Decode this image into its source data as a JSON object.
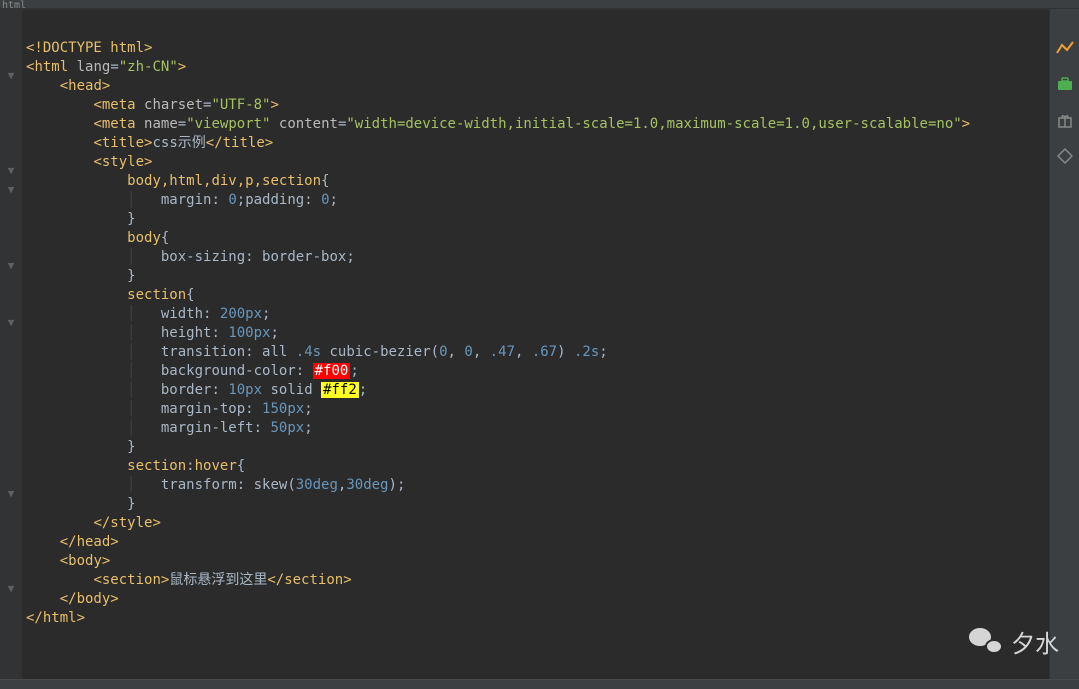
{
  "topbar": {
    "label": "html"
  },
  "folds": [
    "",
    "▼",
    "",
    "",
    "",
    "",
    "▼",
    "▼",
    "",
    "",
    "",
    "▼",
    "",
    "",
    "▼",
    "",
    "",
    "",
    "",
    "",
    "",
    "",
    "",
    "▼",
    "",
    "",
    "",
    "",
    "▼",
    ""
  ],
  "code": {
    "l1": {
      "doctype": "<!DOCTYPE html>"
    },
    "l2": {
      "open": "<",
      "tag": "html",
      "attr": "lang",
      "eq": "=",
      "val": "\"zh-CN\"",
      "close": ">"
    },
    "l3": {
      "open": "<",
      "tag": "head",
      "close": ">"
    },
    "l4": {
      "open": "<",
      "tag": "meta",
      "attr": "charset",
      "eq": "=",
      "val": "\"UTF-8\"",
      "close": ">"
    },
    "l5": {
      "open": "<",
      "tag": "meta",
      "attr1": "name",
      "eq1": "=",
      "val1": "\"viewport\"",
      "attr2": "content",
      "eq2": "=",
      "val2": "\"width=device-width,initial-scale=1.0,maximum-scale=1.0,user-scalable=no\"",
      "close": ">"
    },
    "l6": {
      "open": "<",
      "tag": "title",
      "close1": ">",
      "text": "css示例",
      "open2": "</",
      "close2": ">"
    },
    "l7": {
      "open": "<",
      "tag": "style",
      "close": ">"
    },
    "l8": {
      "sel": "body,html,div,p,section",
      "brace": "{"
    },
    "l9": {
      "p1": "margin",
      "c1": ":",
      "v1": " 0",
      "sc1": ";",
      "p2": "padding",
      "c2": ":",
      "v2": " 0",
      "sc2": ";"
    },
    "l10": {
      "brace": "}"
    },
    "l11": {
      "sel": "body",
      "brace": "{"
    },
    "l12": {
      "p1": "box-sizing",
      "c1": ":",
      "v1": " border-box",
      "sc1": ";"
    },
    "l13": {
      "brace": "}"
    },
    "l14": {
      "sel": "section",
      "brace": "{"
    },
    "l15": {
      "p1": "width",
      "c1": ":",
      "v1": " 200px",
      "sc1": ";"
    },
    "l16": {
      "p1": "height",
      "c1": ":",
      "v1": " 100px",
      "sc1": ";"
    },
    "l17": {
      "p1": "transition",
      "c1": ":",
      "v1": " all ",
      "v2": ".4s",
      "v3": " cubic-bezier(",
      "n1": "0",
      "cm1": ", ",
      "n2": "0",
      "cm2": ", ",
      "n3": ".47",
      "cm3": ", ",
      "n4": ".67",
      "rp": ") ",
      "v4": ".2s",
      "sc1": ";"
    },
    "l18": {
      "p1": "background-color",
      "c1": ":",
      "sp": " ",
      "v1": "#f00",
      "sc1": ";"
    },
    "l19": {
      "p1": "border",
      "c1": ":",
      "v1": " 10px",
      "v2": " solid ",
      "v3": "#ff2",
      "sc1": ";"
    },
    "l20": {
      "p1": "margin-top",
      "c1": ":",
      "v1": " 150px",
      "sc1": ";"
    },
    "l21": {
      "p1": "margin-left",
      "c1": ":",
      "v1": " 50px",
      "sc1": ";"
    },
    "l22": {
      "brace": "}"
    },
    "l23": {
      "sel1": "section",
      "colon": ":",
      "sel2": "hover",
      "brace": "{"
    },
    "l24": {
      "p1": "transform",
      "c1": ":",
      "v1": " skew(",
      "n1": "30deg",
      "cm": ",",
      "n2": "30deg",
      "rp": ")",
      "sc1": ";"
    },
    "l25": {
      "brace": "}"
    },
    "l26": {
      "open": "</",
      "tag": "style",
      "close": ">"
    },
    "l27": {
      "open": "</",
      "tag": "head",
      "close": ">"
    },
    "l28": {
      "open": "<",
      "tag": "body",
      "close": ">"
    },
    "l29": {
      "open": "<",
      "tag": "section",
      "close1": ">",
      "text": "鼠标悬浮到这里",
      "open2": "</",
      "close2": ">"
    },
    "l30": {
      "open": "</",
      "tag": "body",
      "close": ">"
    },
    "l31": {
      "open": "</",
      "tag": "html",
      "close": ">"
    }
  },
  "watermark": {
    "name": "夕水"
  }
}
